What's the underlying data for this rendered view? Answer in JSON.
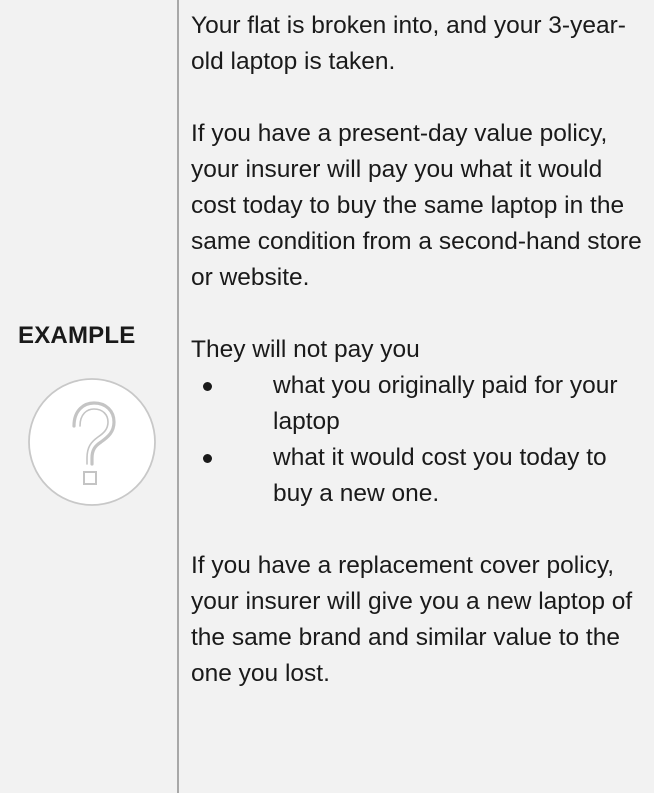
{
  "example": {
    "label": "EXAMPLE",
    "icon": "question-circle-icon"
  },
  "content": {
    "p1": "Your flat is broken into, and your 3-year-old laptop is taken.",
    "p2": "If you have a present-day value policy, your insurer will pay you what it would cost today to buy the same laptop in the same condition from a second-hand store or website.",
    "p3": "They will not pay you",
    "bullets": [
      "what you originally paid for your laptop",
      "what it would cost you today to buy a new one."
    ],
    "p4": "If you have a replacement cover policy, your insurer will give you a new laptop of the same brand and similar value to the one you lost."
  }
}
